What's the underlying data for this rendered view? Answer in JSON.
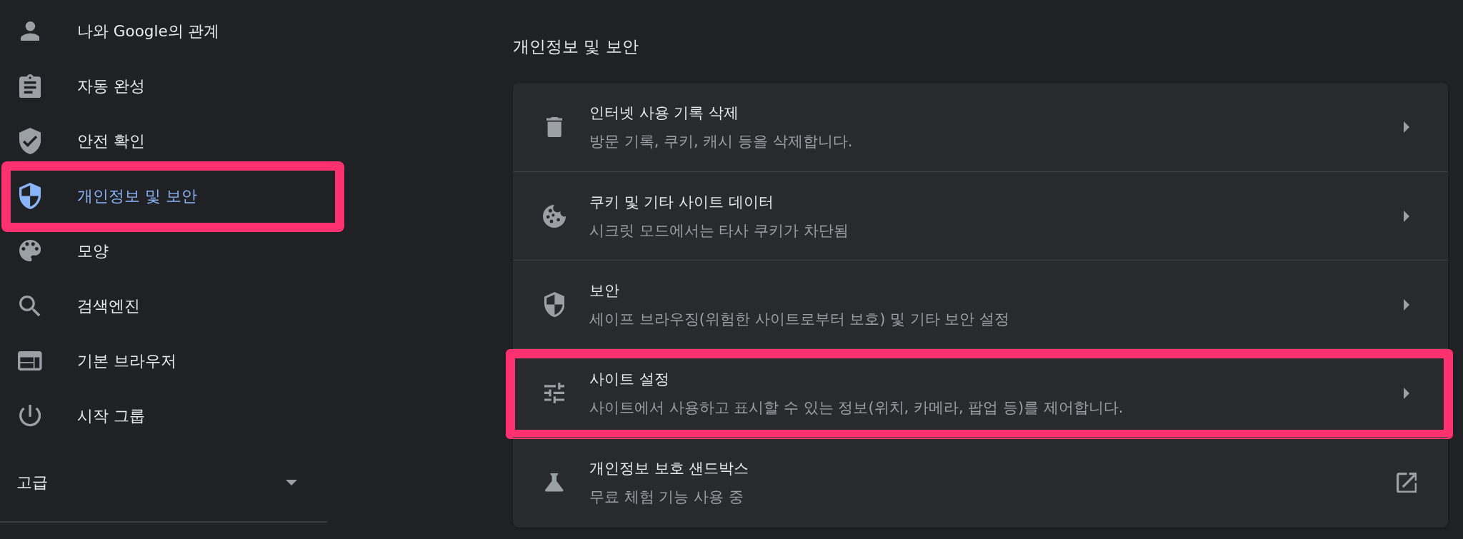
{
  "sidebar": {
    "items": [
      {
        "label": "나와 Google의 관계",
        "selected": false,
        "highlighted": false
      },
      {
        "label": "자동 완성",
        "selected": false,
        "highlighted": false
      },
      {
        "label": "안전 확인",
        "selected": false,
        "highlighted": false
      },
      {
        "label": "개인정보 및 보안",
        "selected": true,
        "highlighted": true
      },
      {
        "label": "모양",
        "selected": false,
        "highlighted": false
      },
      {
        "label": "검색엔진",
        "selected": false,
        "highlighted": false
      },
      {
        "label": "기본 브라우저",
        "selected": false,
        "highlighted": false
      },
      {
        "label": "시작 그룹",
        "selected": false,
        "highlighted": false
      }
    ],
    "advanced": {
      "label": "고급",
      "expanded": false
    }
  },
  "main": {
    "title": "개인정보 및 보안",
    "rows": [
      {
        "title": "인터넷 사용 기록 삭제",
        "subtitle": "방문 기록, 쿠키, 캐시 등을 삭제합니다.",
        "kind": "subpage",
        "highlighted": false
      },
      {
        "title": "쿠키 및 기타 사이트 데이터",
        "subtitle": "시크릿 모드에서는 타사 쿠키가 차단됨",
        "kind": "subpage",
        "highlighted": false
      },
      {
        "title": "보안",
        "subtitle": "세이프 브라우징(위험한 사이트로부터 보호) 및 기타 보안 설정",
        "kind": "subpage",
        "highlighted": false
      },
      {
        "title": "사이트 설정",
        "subtitle": "사이트에서 사용하고 표시할 수 있는 정보(위치, 카메라, 팝업 등)를 제어합니다.",
        "kind": "subpage",
        "highlighted": true
      },
      {
        "title": "개인정보 보호 샌드박스",
        "subtitle": "무료 체험 기능 사용 중",
        "kind": "external",
        "highlighted": false
      }
    ]
  }
}
